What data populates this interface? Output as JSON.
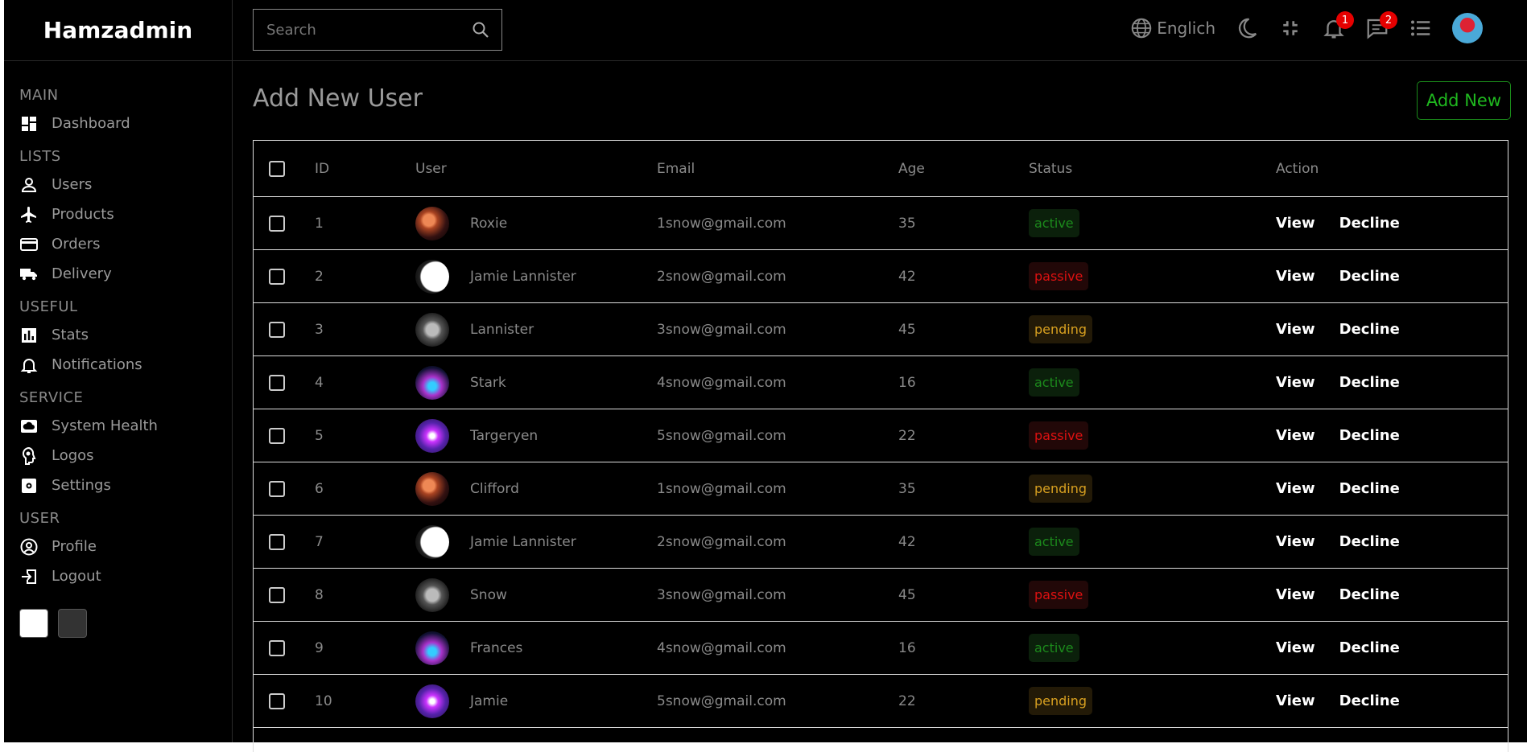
{
  "app": {
    "logo": "Hamzadmin"
  },
  "sidebar": {
    "sections": [
      {
        "title": "MAIN",
        "items": [
          {
            "label": "Dashboard",
            "icon": "dashboard-icon"
          }
        ]
      },
      {
        "title": "LISTS",
        "items": [
          {
            "label": "Users",
            "icon": "person-icon"
          },
          {
            "label": "Products",
            "icon": "airplane-icon"
          },
          {
            "label": "Orders",
            "icon": "credit-card-icon"
          },
          {
            "label": "Delivery",
            "icon": "truck-icon"
          }
        ]
      },
      {
        "title": "USEFUL",
        "items": [
          {
            "label": "Stats",
            "icon": "bar-chart-icon"
          },
          {
            "label": "Notifications",
            "icon": "bell-icon"
          }
        ]
      },
      {
        "title": "SERVICE",
        "items": [
          {
            "label": "System Health",
            "icon": "cloud-icon"
          },
          {
            "label": "Logos",
            "icon": "brain-icon"
          },
          {
            "label": "Settings",
            "icon": "settings-icon"
          }
        ]
      },
      {
        "title": "USER",
        "items": [
          {
            "label": "Profile",
            "icon": "account-circle-icon"
          },
          {
            "label": "Logout",
            "icon": "logout-icon"
          }
        ]
      }
    ],
    "themes": {
      "light": "#ffffff",
      "dark": "#333333"
    }
  },
  "topbar": {
    "search_placeholder": "Search",
    "language": "Englich",
    "notifications_count": "1",
    "messages_count": "2"
  },
  "main": {
    "title": "Add New User",
    "add_button": "Add New",
    "columns": [
      "ID",
      "User",
      "Email",
      "Age",
      "Status",
      "Action"
    ],
    "actions": {
      "view": "View",
      "decline": "Decline"
    },
    "rows": [
      {
        "id": "1",
        "user": "Roxie",
        "email": "1snow@gmail.com",
        "age": "35",
        "status": "active"
      },
      {
        "id": "2",
        "user": "Jamie Lannister",
        "email": "2snow@gmail.com",
        "age": "42",
        "status": "passive"
      },
      {
        "id": "3",
        "user": "Lannister",
        "email": "3snow@gmail.com",
        "age": "45",
        "status": "pending"
      },
      {
        "id": "4",
        "user": "Stark",
        "email": "4snow@gmail.com",
        "age": "16",
        "status": "active"
      },
      {
        "id": "5",
        "user": "Targeryen",
        "email": "5snow@gmail.com",
        "age": "22",
        "status": "passive"
      },
      {
        "id": "6",
        "user": "Clifford",
        "email": "1snow@gmail.com",
        "age": "35",
        "status": "pending"
      },
      {
        "id": "7",
        "user": "Jamie Lannister",
        "email": "2snow@gmail.com",
        "age": "42",
        "status": "active"
      },
      {
        "id": "8",
        "user": "Snow",
        "email": "3snow@gmail.com",
        "age": "45",
        "status": "passive"
      },
      {
        "id": "9",
        "user": "Frances",
        "email": "4snow@gmail.com",
        "age": "16",
        "status": "active"
      },
      {
        "id": "10",
        "user": "Jamie",
        "email": "5snow@gmail.com",
        "age": "22",
        "status": "pending"
      }
    ]
  }
}
